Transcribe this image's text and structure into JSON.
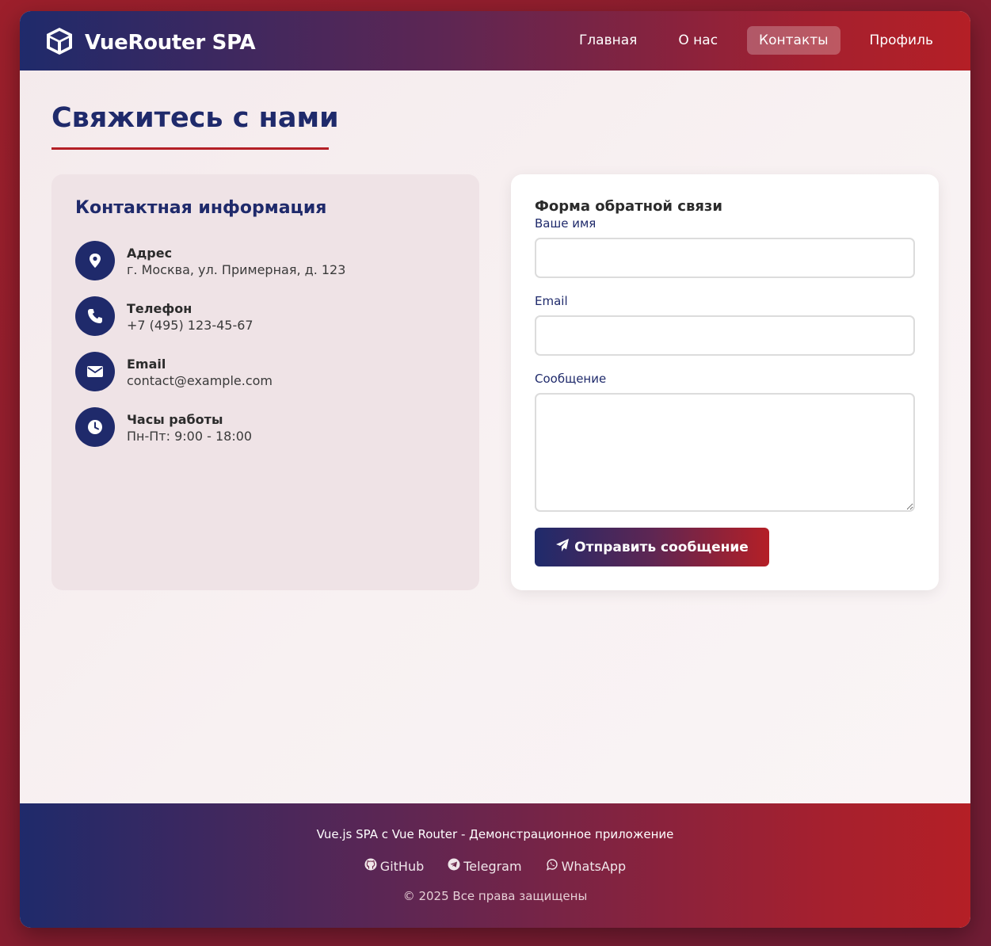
{
  "header": {
    "brand_title": "VueRouter SPA",
    "brand_icon": "cube-icon",
    "nav": [
      {
        "label": "Главная",
        "active": false
      },
      {
        "label": "О нас",
        "active": false
      },
      {
        "label": "Контакты",
        "active": true
      },
      {
        "label": "Профиль",
        "active": false
      }
    ]
  },
  "page": {
    "title": "Свяжитесь с нами"
  },
  "contact_info": {
    "heading": "Контактная информация",
    "items": [
      {
        "icon": "map-pin-icon",
        "label": "Адрес",
        "value": "г. Москва, ул. Примерная, д. 123"
      },
      {
        "icon": "phone-icon",
        "label": "Телефон",
        "value": "+7 (495) 123-45-67"
      },
      {
        "icon": "envelope-icon",
        "label": "Email",
        "value": "contact@example.com"
      },
      {
        "icon": "clock-icon",
        "label": "Часы работы",
        "value": "Пн-Пт: 9:00 - 18:00"
      }
    ]
  },
  "form": {
    "heading": "Форма обратной связи",
    "name_label": "Ваше имя",
    "name_value": "",
    "email_label": "Email",
    "email_value": "",
    "message_label": "Сообщение",
    "message_value": "",
    "submit_label": "Отправить сообщение",
    "submit_icon": "paper-plane-icon"
  },
  "footer": {
    "description": "Vue.js SPA с Vue Router - Демонстрационное приложение",
    "links": [
      {
        "icon": "github-icon",
        "label": "GitHub"
      },
      {
        "icon": "telegram-icon",
        "label": "Telegram"
      },
      {
        "icon": "whatsapp-icon",
        "label": "WhatsApp"
      }
    ],
    "copyright": "© 2025 Все права защищены"
  },
  "colors": {
    "primary": "#1f2a6b",
    "accent": "#b41f26",
    "background": "#9c1f2b"
  }
}
